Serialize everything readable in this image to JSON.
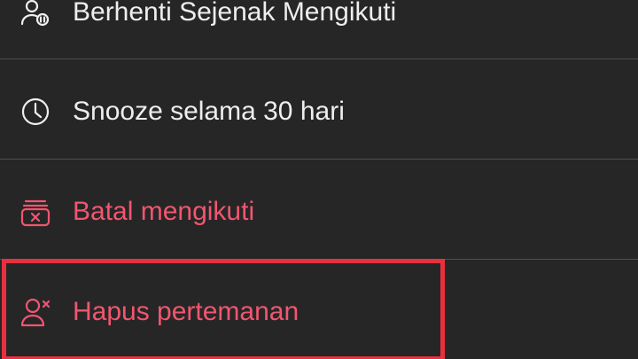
{
  "menu": {
    "items": [
      {
        "label": "Berhenti Sejenak Mengikuti",
        "icon": "pause-follow-icon",
        "tone": "normal"
      },
      {
        "label": "Snooze selama 30 hari",
        "icon": "clock-icon",
        "tone": "normal"
      },
      {
        "label": "Batal mengikuti",
        "icon": "unfollow-box-icon",
        "tone": "danger"
      },
      {
        "label": "Hapus pertemanan",
        "icon": "remove-friend-icon",
        "tone": "danger"
      }
    ]
  },
  "colors": {
    "background": "#262627",
    "text": "#eeeeef",
    "danger": "#f2566f",
    "divider": "#4e4e50",
    "highlight_border": "#e8303e"
  }
}
